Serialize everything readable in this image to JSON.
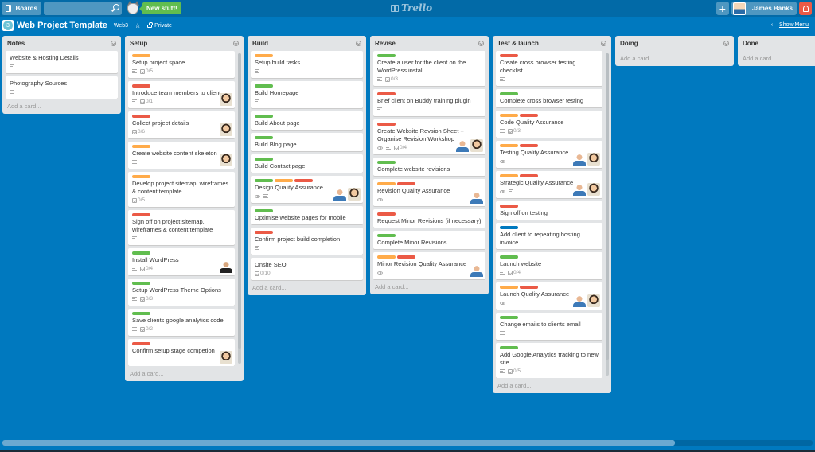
{
  "topbar": {
    "boards_label": "Boards",
    "search_value": "",
    "new_stuff_label": "New stuff!",
    "logo_text": "Trello",
    "add_label": "+",
    "user_name": "James Banks"
  },
  "board": {
    "badge_letter": "3",
    "title": "Web Project Template",
    "team": "Web3",
    "star": "☆",
    "visibility": "Private",
    "show_menu_chevron": "‹",
    "show_menu_label": "Show Menu"
  },
  "colors": {
    "green": "#61bd4f",
    "orange": "#ffab4a",
    "red": "#eb5a46",
    "blue": "#0079bf",
    "board_bg": "#0079bf"
  },
  "add_card_label": "Add a card...",
  "lists": [
    {
      "title": "Notes",
      "cards": [
        {
          "title": "Website & Hosting Details",
          "labels": [],
          "desc": true
        },
        {
          "title": "Photography Sources",
          "labels": [],
          "desc": true
        }
      ]
    },
    {
      "title": "Setup",
      "cards": [
        {
          "title": "Setup project space",
          "labels": [
            "orange"
          ],
          "desc": true,
          "checklist": "0/5"
        },
        {
          "title": "Introduce team members to client",
          "labels": [
            "red"
          ],
          "desc": true,
          "checklist": "0/1",
          "members": [
            "m1"
          ]
        },
        {
          "title": "Collect project details",
          "labels": [
            "red"
          ],
          "checklist": "0/6",
          "members": [
            "m1"
          ]
        },
        {
          "title": "Create website content skeleton",
          "labels": [
            "orange"
          ],
          "desc": true,
          "members": [
            "m1"
          ]
        },
        {
          "title": "Develop project sitemap, wireframes & content template",
          "labels": [
            "orange"
          ],
          "checklist": "0/5"
        },
        {
          "title": "Sign off on project sitemap, wireframes & content template",
          "labels": [
            "red"
          ],
          "desc": true
        },
        {
          "title": "Install WordPress",
          "labels": [
            "green"
          ],
          "desc": true,
          "checklist": "0/4",
          "members": [
            "m3"
          ]
        },
        {
          "title": "Setup WordPress Theme Options",
          "labels": [
            "green"
          ],
          "desc": true,
          "checklist": "0/3"
        },
        {
          "title": "Save clients google analytics code",
          "labels": [
            "green"
          ],
          "desc": true,
          "checklist": "0/2"
        },
        {
          "title": "Confirm setup stage competion",
          "labels": [
            "red"
          ],
          "members": [
            "m1"
          ]
        }
      ]
    },
    {
      "title": "Build",
      "cards": [
        {
          "title": "Setup build tasks",
          "labels": [
            "orange"
          ],
          "desc": true
        },
        {
          "title": "Build Homepage",
          "labels": [
            "green"
          ],
          "desc": true
        },
        {
          "title": "Build About page",
          "labels": [
            "green"
          ]
        },
        {
          "title": "Build Blog page",
          "labels": [
            "green"
          ]
        },
        {
          "title": "Build Contact page",
          "labels": [
            "green"
          ]
        },
        {
          "title": "Design Quality Assurance",
          "labels": [
            "green",
            "orange",
            "red"
          ],
          "watch": true,
          "desc": true,
          "members": [
            "m2",
            "m1"
          ]
        },
        {
          "title": "Optimise website pages for mobile",
          "labels": [
            "green"
          ]
        },
        {
          "title": "Confirm project build completion",
          "labels": [
            "red"
          ],
          "desc": true
        },
        {
          "title": "Onsite SEO",
          "labels": [],
          "checklist": "0/10"
        }
      ]
    },
    {
      "title": "Revise",
      "cards": [
        {
          "title": "Create a user for the client on the WordPress install",
          "labels": [
            "green"
          ],
          "desc": true,
          "checklist": "0/3"
        },
        {
          "title": "Brief client on Buddy training plugin",
          "labels": [
            "red"
          ],
          "desc": true
        },
        {
          "title": "Create Website Revsion Sheet + Organise Revision Workshop",
          "labels": [
            "red"
          ],
          "watch": true,
          "desc": true,
          "checklist": "0/4",
          "members": [
            "m2",
            "m1"
          ]
        },
        {
          "title": "Complete website revisions",
          "labels": [
            "green"
          ]
        },
        {
          "title": "Revision Quality Assurance",
          "labels": [
            "orange",
            "red"
          ],
          "watch": true,
          "members": [
            "m2"
          ]
        },
        {
          "title": "Request Minor Revisions (if necessary)",
          "labels": [
            "red"
          ]
        },
        {
          "title": "Complete Minor Revisions",
          "labels": [
            "green"
          ]
        },
        {
          "title": "Minor Revision Quality Assurance",
          "labels": [
            "orange",
            "red"
          ],
          "watch": true,
          "members": [
            "m2"
          ]
        }
      ]
    },
    {
      "title": "Test & launch",
      "cards": [
        {
          "title": "Create cross browser testing checklist",
          "labels": [
            "red"
          ],
          "desc": true
        },
        {
          "title": "Complete cross browser testing",
          "labels": [
            "green"
          ]
        },
        {
          "title": "Code Quality Assurance",
          "labels": [
            "orange",
            "red"
          ],
          "desc": true,
          "checklist": "0/3"
        },
        {
          "title": "Testing Quality Assurance",
          "labels": [
            "orange",
            "red"
          ],
          "watch": true,
          "members": [
            "m2",
            "m1"
          ]
        },
        {
          "title": "Strategic Quality Assurance",
          "labels": [
            "orange",
            "red"
          ],
          "watch": true,
          "desc": true,
          "members": [
            "m2",
            "m1"
          ]
        },
        {
          "title": "Sign off on testing",
          "labels": [
            "red"
          ]
        },
        {
          "title": "Add client to repeating hosting invoice",
          "labels": [
            "blue"
          ]
        },
        {
          "title": "Launch website",
          "labels": [
            "green"
          ],
          "desc": true,
          "checklist": "0/4"
        },
        {
          "title": "Launch Quality Assurance",
          "labels": [
            "orange",
            "red"
          ],
          "watch": true,
          "members": [
            "m2",
            "m1"
          ]
        },
        {
          "title": "Change emails to clients email",
          "labels": [
            "green"
          ],
          "desc": true
        },
        {
          "title": "Add Google Analytics tracking to new site",
          "labels": [
            "green"
          ],
          "desc": true,
          "checklist": "0/5"
        }
      ]
    },
    {
      "title": "Doing",
      "cards": []
    },
    {
      "title": "Done",
      "cards": []
    }
  ]
}
